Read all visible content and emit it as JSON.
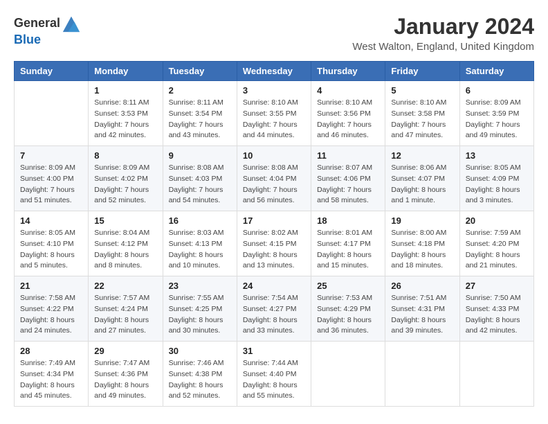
{
  "logo": {
    "general": "General",
    "blue": "Blue"
  },
  "title": "January 2024",
  "subtitle": "West Walton, England, United Kingdom",
  "header_days": [
    "Sunday",
    "Monday",
    "Tuesday",
    "Wednesday",
    "Thursday",
    "Friday",
    "Saturday"
  ],
  "weeks": [
    [
      {
        "day": "",
        "sunrise": "",
        "sunset": "",
        "daylight": ""
      },
      {
        "day": "1",
        "sunrise": "Sunrise: 8:11 AM",
        "sunset": "Sunset: 3:53 PM",
        "daylight": "Daylight: 7 hours and 42 minutes."
      },
      {
        "day": "2",
        "sunrise": "Sunrise: 8:11 AM",
        "sunset": "Sunset: 3:54 PM",
        "daylight": "Daylight: 7 hours and 43 minutes."
      },
      {
        "day": "3",
        "sunrise": "Sunrise: 8:10 AM",
        "sunset": "Sunset: 3:55 PM",
        "daylight": "Daylight: 7 hours and 44 minutes."
      },
      {
        "day": "4",
        "sunrise": "Sunrise: 8:10 AM",
        "sunset": "Sunset: 3:56 PM",
        "daylight": "Daylight: 7 hours and 46 minutes."
      },
      {
        "day": "5",
        "sunrise": "Sunrise: 8:10 AM",
        "sunset": "Sunset: 3:58 PM",
        "daylight": "Daylight: 7 hours and 47 minutes."
      },
      {
        "day": "6",
        "sunrise": "Sunrise: 8:09 AM",
        "sunset": "Sunset: 3:59 PM",
        "daylight": "Daylight: 7 hours and 49 minutes."
      }
    ],
    [
      {
        "day": "7",
        "sunrise": "Sunrise: 8:09 AM",
        "sunset": "Sunset: 4:00 PM",
        "daylight": "Daylight: 7 hours and 51 minutes."
      },
      {
        "day": "8",
        "sunrise": "Sunrise: 8:09 AM",
        "sunset": "Sunset: 4:02 PM",
        "daylight": "Daylight: 7 hours and 52 minutes."
      },
      {
        "day": "9",
        "sunrise": "Sunrise: 8:08 AM",
        "sunset": "Sunset: 4:03 PM",
        "daylight": "Daylight: 7 hours and 54 minutes."
      },
      {
        "day": "10",
        "sunrise": "Sunrise: 8:08 AM",
        "sunset": "Sunset: 4:04 PM",
        "daylight": "Daylight: 7 hours and 56 minutes."
      },
      {
        "day": "11",
        "sunrise": "Sunrise: 8:07 AM",
        "sunset": "Sunset: 4:06 PM",
        "daylight": "Daylight: 7 hours and 58 minutes."
      },
      {
        "day": "12",
        "sunrise": "Sunrise: 8:06 AM",
        "sunset": "Sunset: 4:07 PM",
        "daylight": "Daylight: 8 hours and 1 minute."
      },
      {
        "day": "13",
        "sunrise": "Sunrise: 8:05 AM",
        "sunset": "Sunset: 4:09 PM",
        "daylight": "Daylight: 8 hours and 3 minutes."
      }
    ],
    [
      {
        "day": "14",
        "sunrise": "Sunrise: 8:05 AM",
        "sunset": "Sunset: 4:10 PM",
        "daylight": "Daylight: 8 hours and 5 minutes."
      },
      {
        "day": "15",
        "sunrise": "Sunrise: 8:04 AM",
        "sunset": "Sunset: 4:12 PM",
        "daylight": "Daylight: 8 hours and 8 minutes."
      },
      {
        "day": "16",
        "sunrise": "Sunrise: 8:03 AM",
        "sunset": "Sunset: 4:13 PM",
        "daylight": "Daylight: 8 hours and 10 minutes."
      },
      {
        "day": "17",
        "sunrise": "Sunrise: 8:02 AM",
        "sunset": "Sunset: 4:15 PM",
        "daylight": "Daylight: 8 hours and 13 minutes."
      },
      {
        "day": "18",
        "sunrise": "Sunrise: 8:01 AM",
        "sunset": "Sunset: 4:17 PM",
        "daylight": "Daylight: 8 hours and 15 minutes."
      },
      {
        "day": "19",
        "sunrise": "Sunrise: 8:00 AM",
        "sunset": "Sunset: 4:18 PM",
        "daylight": "Daylight: 8 hours and 18 minutes."
      },
      {
        "day": "20",
        "sunrise": "Sunrise: 7:59 AM",
        "sunset": "Sunset: 4:20 PM",
        "daylight": "Daylight: 8 hours and 21 minutes."
      }
    ],
    [
      {
        "day": "21",
        "sunrise": "Sunrise: 7:58 AM",
        "sunset": "Sunset: 4:22 PM",
        "daylight": "Daylight: 8 hours and 24 minutes."
      },
      {
        "day": "22",
        "sunrise": "Sunrise: 7:57 AM",
        "sunset": "Sunset: 4:24 PM",
        "daylight": "Daylight: 8 hours and 27 minutes."
      },
      {
        "day": "23",
        "sunrise": "Sunrise: 7:55 AM",
        "sunset": "Sunset: 4:25 PM",
        "daylight": "Daylight: 8 hours and 30 minutes."
      },
      {
        "day": "24",
        "sunrise": "Sunrise: 7:54 AM",
        "sunset": "Sunset: 4:27 PM",
        "daylight": "Daylight: 8 hours and 33 minutes."
      },
      {
        "day": "25",
        "sunrise": "Sunrise: 7:53 AM",
        "sunset": "Sunset: 4:29 PM",
        "daylight": "Daylight: 8 hours and 36 minutes."
      },
      {
        "day": "26",
        "sunrise": "Sunrise: 7:51 AM",
        "sunset": "Sunset: 4:31 PM",
        "daylight": "Daylight: 8 hours and 39 minutes."
      },
      {
        "day": "27",
        "sunrise": "Sunrise: 7:50 AM",
        "sunset": "Sunset: 4:33 PM",
        "daylight": "Daylight: 8 hours and 42 minutes."
      }
    ],
    [
      {
        "day": "28",
        "sunrise": "Sunrise: 7:49 AM",
        "sunset": "Sunset: 4:34 PM",
        "daylight": "Daylight: 8 hours and 45 minutes."
      },
      {
        "day": "29",
        "sunrise": "Sunrise: 7:47 AM",
        "sunset": "Sunset: 4:36 PM",
        "daylight": "Daylight: 8 hours and 49 minutes."
      },
      {
        "day": "30",
        "sunrise": "Sunrise: 7:46 AM",
        "sunset": "Sunset: 4:38 PM",
        "daylight": "Daylight: 8 hours and 52 minutes."
      },
      {
        "day": "31",
        "sunrise": "Sunrise: 7:44 AM",
        "sunset": "Sunset: 4:40 PM",
        "daylight": "Daylight: 8 hours and 55 minutes."
      },
      {
        "day": "",
        "sunrise": "",
        "sunset": "",
        "daylight": ""
      },
      {
        "day": "",
        "sunrise": "",
        "sunset": "",
        "daylight": ""
      },
      {
        "day": "",
        "sunrise": "",
        "sunset": "",
        "daylight": ""
      }
    ]
  ]
}
